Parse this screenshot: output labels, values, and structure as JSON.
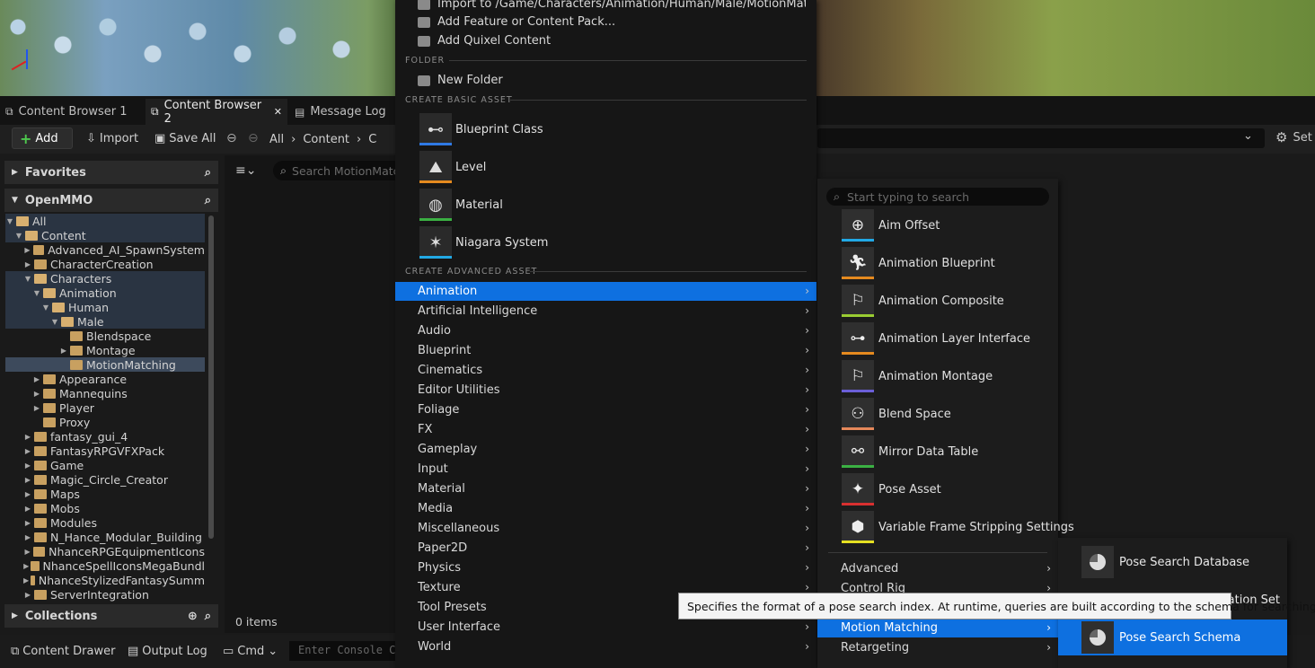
{
  "tabs": {
    "tab1": "Content Browser 1",
    "tab2": "Content Browser 2",
    "tab3": "Message Log"
  },
  "toolbar": {
    "add": "Add",
    "import": "Import",
    "save_all": "Save All",
    "settings": "Set"
  },
  "path": {
    "all": "All",
    "content": "Content",
    "truncated": "C"
  },
  "favorites": {
    "title": "Favorites"
  },
  "project": {
    "title": "OpenMMO"
  },
  "collections": {
    "title": "Collections"
  },
  "filter_search": {
    "placeholder": "Search MotionMatc"
  },
  "items_count": "0 items",
  "tree": [
    {
      "label": "All"
    },
    {
      "label": "Content"
    },
    {
      "label": "Advanced_AI_SpawnSystem"
    },
    {
      "label": "CharacterCreation"
    },
    {
      "label": "Characters"
    },
    {
      "label": "Animation"
    },
    {
      "label": "Human"
    },
    {
      "label": "Male"
    },
    {
      "label": "Blendspace"
    },
    {
      "label": "Montage"
    },
    {
      "label": "MotionMatching"
    },
    {
      "label": "Appearance"
    },
    {
      "label": "Mannequins"
    },
    {
      "label": "Player"
    },
    {
      "label": "Proxy"
    },
    {
      "label": "fantasy_gui_4"
    },
    {
      "label": "FantasyRPGVFXPack"
    },
    {
      "label": "Game"
    },
    {
      "label": "Magic_Circle_Creator"
    },
    {
      "label": "Maps"
    },
    {
      "label": "Mobs"
    },
    {
      "label": "Modules"
    },
    {
      "label": "N_Hance_Modular_Building"
    },
    {
      "label": "NhanceRPGEquipmentIcons"
    },
    {
      "label": "NhanceSpellIconsMegaBundl"
    },
    {
      "label": "NhanceStylizedFantasySumm"
    },
    {
      "label": "ServerIntegration"
    }
  ],
  "bottom": {
    "drawer": "Content Drawer",
    "output": "Output Log",
    "cmd": "Cmd",
    "console_placeholder": "Enter Console C"
  },
  "menu": {
    "import_to": "Import to /Game/Characters/Animation/Human/Male/MotionMatching...",
    "add_feature": "Add Feature or Content Pack...",
    "add_quixel": "Add Quixel Content",
    "folder_hdr": "FOLDER",
    "new_folder": "New Folder",
    "basic_hdr": "CREATE BASIC ASSET",
    "basic": [
      {
        "label": "Blueprint Class",
        "color": "#2f7ae5"
      },
      {
        "label": "Level",
        "color": "#e58a1f"
      },
      {
        "label": "Material",
        "color": "#3bb043"
      },
      {
        "label": "Niagara System",
        "color": "#22a9e5"
      }
    ],
    "advanced_hdr": "CREATE ADVANCED ASSET",
    "categories": [
      "Animation",
      "Artificial Intelligence",
      "Audio",
      "Blueprint",
      "Cinematics",
      "Editor Utilities",
      "Foliage",
      "FX",
      "Gameplay",
      "Input",
      "Material",
      "Media",
      "Miscellaneous",
      "Paper2D",
      "Physics",
      "Texture",
      "Tool Presets",
      "User Interface",
      "World"
    ]
  },
  "submenu": {
    "search_placeholder": "Start typing to search",
    "items": [
      {
        "label": "Aim Offset",
        "color": "#22a9e5"
      },
      {
        "label": "Animation Blueprint",
        "color": "#e58a1f"
      },
      {
        "label": "Animation Composite",
        "color": "#9acd32"
      },
      {
        "label": "Animation Layer Interface",
        "color": "#e58a1f"
      },
      {
        "label": "Animation Montage",
        "color": "#6b5fd8"
      },
      {
        "label": "Blend Space",
        "color": "#e5885a"
      },
      {
        "label": "Mirror Data Table",
        "color": "#3bb043"
      },
      {
        "label": "Pose Asset",
        "color": "#d83030"
      },
      {
        "label": "Variable Frame Stripping Settings",
        "color": "#e5e022"
      }
    ],
    "cats": [
      "Advanced",
      "Control Rig",
      "Motion Matching",
      "Retargeting"
    ]
  },
  "submenu2": {
    "items": [
      "Pose Search Database",
      "ation Set",
      "Pose Search Schema"
    ]
  },
  "tooltip": "Specifies the format of a pose search index. At runtime, queries are built according to the schema for searching."
}
